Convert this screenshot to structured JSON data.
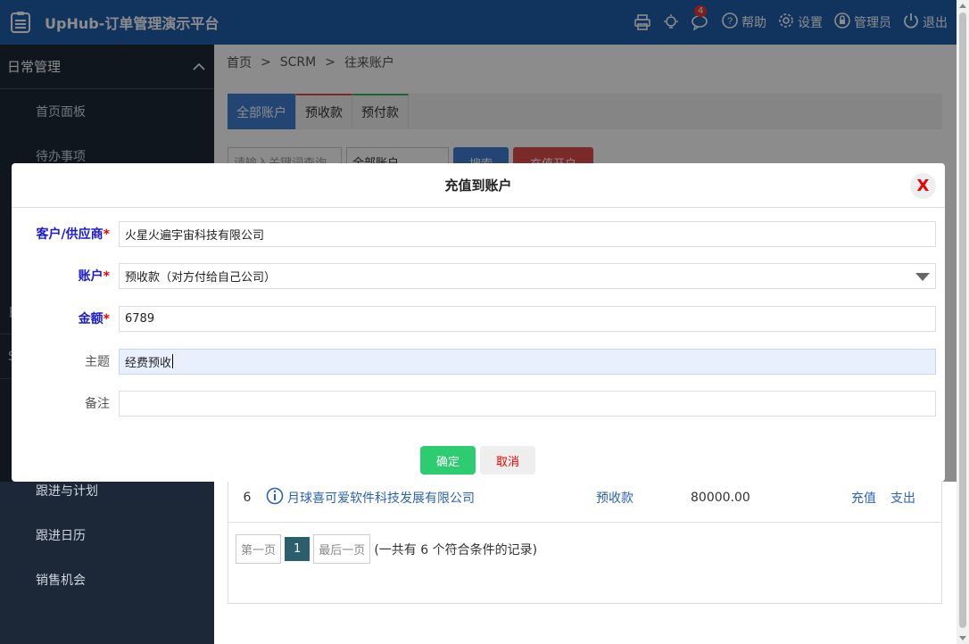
{
  "header": {
    "title": "UpHub-订单管理演示平台",
    "notif_count": "4",
    "help": "帮助",
    "settings": "设置",
    "admin": "管理员",
    "logout": "退出"
  },
  "sidebar": {
    "group_title": "日常管理",
    "items": [
      {
        "label": "首页面板"
      },
      {
        "label": "待办事项"
      }
    ],
    "stubs": [
      "日",
      "S"
    ],
    "bottom_items": [
      {
        "label": "跟进与计划"
      },
      {
        "label": "跟进日历"
      },
      {
        "label": "销售机会"
      }
    ]
  },
  "breadcrumb": {
    "home": "首页",
    "sep": ">",
    "crm": "SCRM",
    "current": "往来账户"
  },
  "tabs": [
    {
      "label": "全部账户"
    },
    {
      "label": "预收款"
    },
    {
      "label": "预付款"
    }
  ],
  "filter": {
    "keyword_placeholder": "请输入关键词查询",
    "select_value": "全部账户",
    "search_label": "搜索",
    "recharge_label": "充值开户"
  },
  "table": {
    "row": {
      "index": "6",
      "company": "月球喜可爱软件科技发展有限公司",
      "type": "预收款",
      "amount": "80000.00",
      "action_recharge": "充值",
      "action_expense": "支出"
    }
  },
  "pager": {
    "first": "第一页",
    "current": "1",
    "last": "最后一页",
    "summary": "(一共有 6 个符合条件的记录)"
  },
  "modal": {
    "title": "充值到账户",
    "close": "X",
    "customer_label": "客户/供应商",
    "customer_value": "火星火遍宇宙科技有限公司",
    "account_label": "账户",
    "account_value": "预收款（对方付给自己公司）",
    "amount_label": "金额",
    "amount_value": "6789",
    "subject_label": "主题",
    "subject_value": "经费预收",
    "remark_label": "备注",
    "remark_value": "",
    "required_mark": "*",
    "ok_label": "确定",
    "cancel_label": "取消"
  },
  "colors": {
    "header_bg": "#1f5fae",
    "sidebar_bg": "#1c2838",
    "ok_green": "#2ecc71",
    "required_blue": "#1a1ad6",
    "required_star": "#e00000"
  }
}
